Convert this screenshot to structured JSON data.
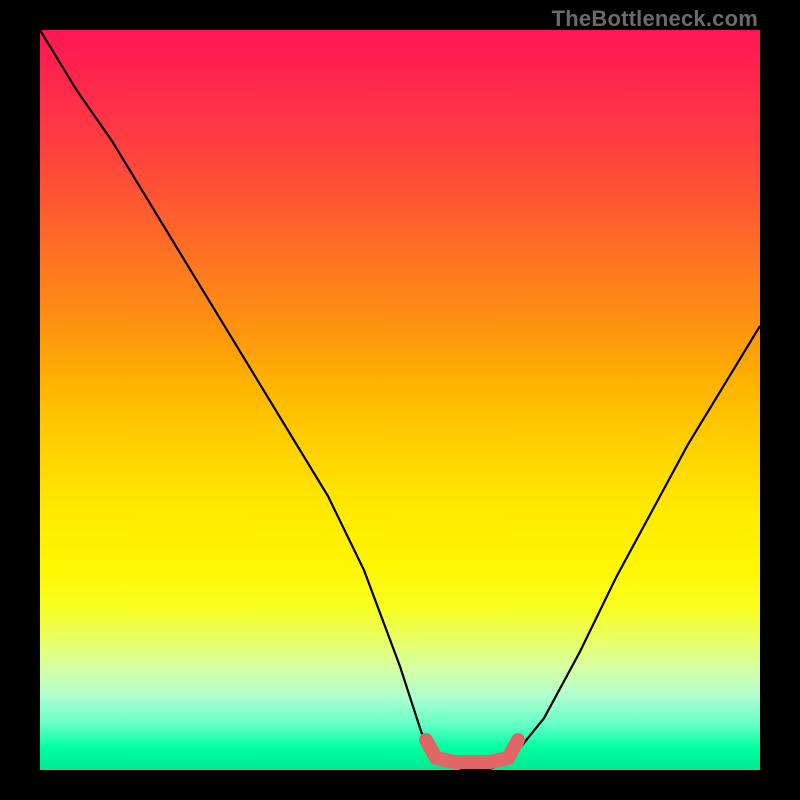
{
  "watermark": "TheBottleneck.com",
  "chart_data": {
    "type": "line",
    "title": "",
    "xlabel": "",
    "ylabel": "",
    "xlim": [
      0,
      100
    ],
    "ylim": [
      0,
      100
    ],
    "series": [
      {
        "name": "bottleneck-curve",
        "x": [
          0,
          5,
          10,
          15,
          20,
          25,
          30,
          35,
          40,
          45,
          50,
          53,
          56,
          59,
          62,
          65,
          70,
          75,
          80,
          85,
          90,
          95,
          100
        ],
        "values": [
          100,
          92,
          85,
          77,
          69,
          61,
          53,
          45,
          37,
          27,
          14,
          5,
          1,
          0,
          0,
          1,
          7,
          16,
          26,
          35,
          44,
          52,
          60
        ]
      }
    ],
    "annotations": [
      {
        "name": "optimal-zone",
        "x_start": 55,
        "x_end": 65,
        "y": 0
      }
    ],
    "gradient_stops": [
      {
        "pos": 0,
        "color": "#ff1654"
      },
      {
        "pos": 50,
        "color": "#ffd000"
      },
      {
        "pos": 80,
        "color": "#f8ff20"
      },
      {
        "pos": 100,
        "color": "#00e890"
      }
    ],
    "accent_color": "#e06666",
    "curve_color": "#000000"
  }
}
